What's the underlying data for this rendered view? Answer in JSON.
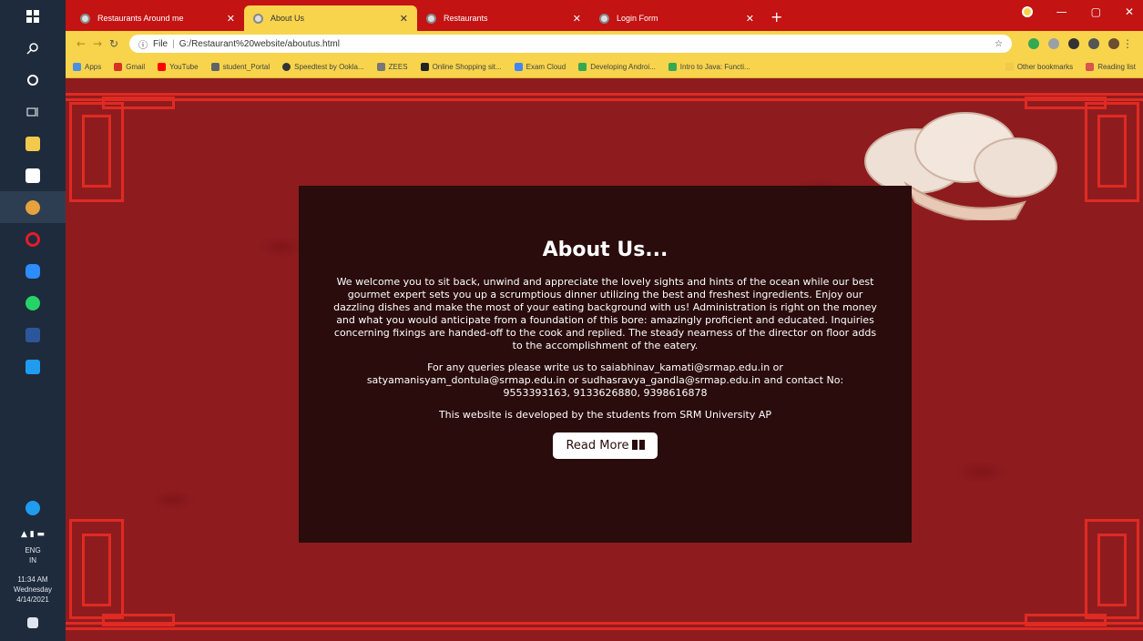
{
  "taskbar": {
    "time": "11:34 AM",
    "day": "Wednesday",
    "date": "4/14/2021",
    "lang": "ENG",
    "region": "IN"
  },
  "tabs": [
    {
      "label": "Restaurants Around me",
      "active": false
    },
    {
      "label": "About Us",
      "active": true
    },
    {
      "label": "Restaurants",
      "active": false
    },
    {
      "label": "Login Form",
      "active": false
    }
  ],
  "address": {
    "scheme": "File",
    "url": "G:/Restaurant%20website/aboutus.html"
  },
  "bookmarks": [
    {
      "label": "Apps",
      "color": "#4a90e2"
    },
    {
      "label": "Gmail",
      "color": "#d93025"
    },
    {
      "label": "YouTube",
      "color": "#ff0000"
    },
    {
      "label": "student_Portal",
      "color": "#5f6368"
    },
    {
      "label": "Speedtest by Ookla...",
      "color": "#333333"
    },
    {
      "label": "ZEES",
      "color": "#777777"
    },
    {
      "label": "Online Shopping sit...",
      "color": "#222222"
    },
    {
      "label": "Exam Cloud",
      "color": "#4285f4"
    },
    {
      "label": "Developing Androi...",
      "color": "#34a853"
    },
    {
      "label": "Intro to Java: Functi...",
      "color": "#34a853"
    }
  ],
  "bookmarks_right": [
    {
      "label": "Other bookmarks"
    },
    {
      "label": "Reading list"
    }
  ],
  "about": {
    "title": "About Us...",
    "paragraph1": "We welcome you to sit back, unwind and appreciate the lovely sights and hints of the ocean while our best gourmet expert sets you up a scrumptious dinner utilizing the best and freshest ingredients. Enjoy our dazzling dishes and make the most of your eating background with us! Administration is right on the money and what you would anticipate from a foundation of this bore: amazingly proficient and educated. Inquiries concerning fixings are handed-off to the cook and replied. The steady nearness of the director on floor adds to the accomplishment of the eatery.",
    "paragraph2": "For any queries please write us to saiabhinav_kamati@srmap.edu.in or satyamanisyam_dontula@srmap.edu.in or sudhasravya_gandla@srmap.edu.in and contact No: 9553393163, 9133626880, 9398616878",
    "paragraph3": "This website is developed by the students from SRM University AP",
    "button_label": "Read More"
  },
  "colors": {
    "tabbar": "#c31313",
    "toolbar": "#f7d44c",
    "page_bg": "#8e1c1f",
    "card_bg": "#2a0c0c",
    "frame": "#e02a22"
  }
}
